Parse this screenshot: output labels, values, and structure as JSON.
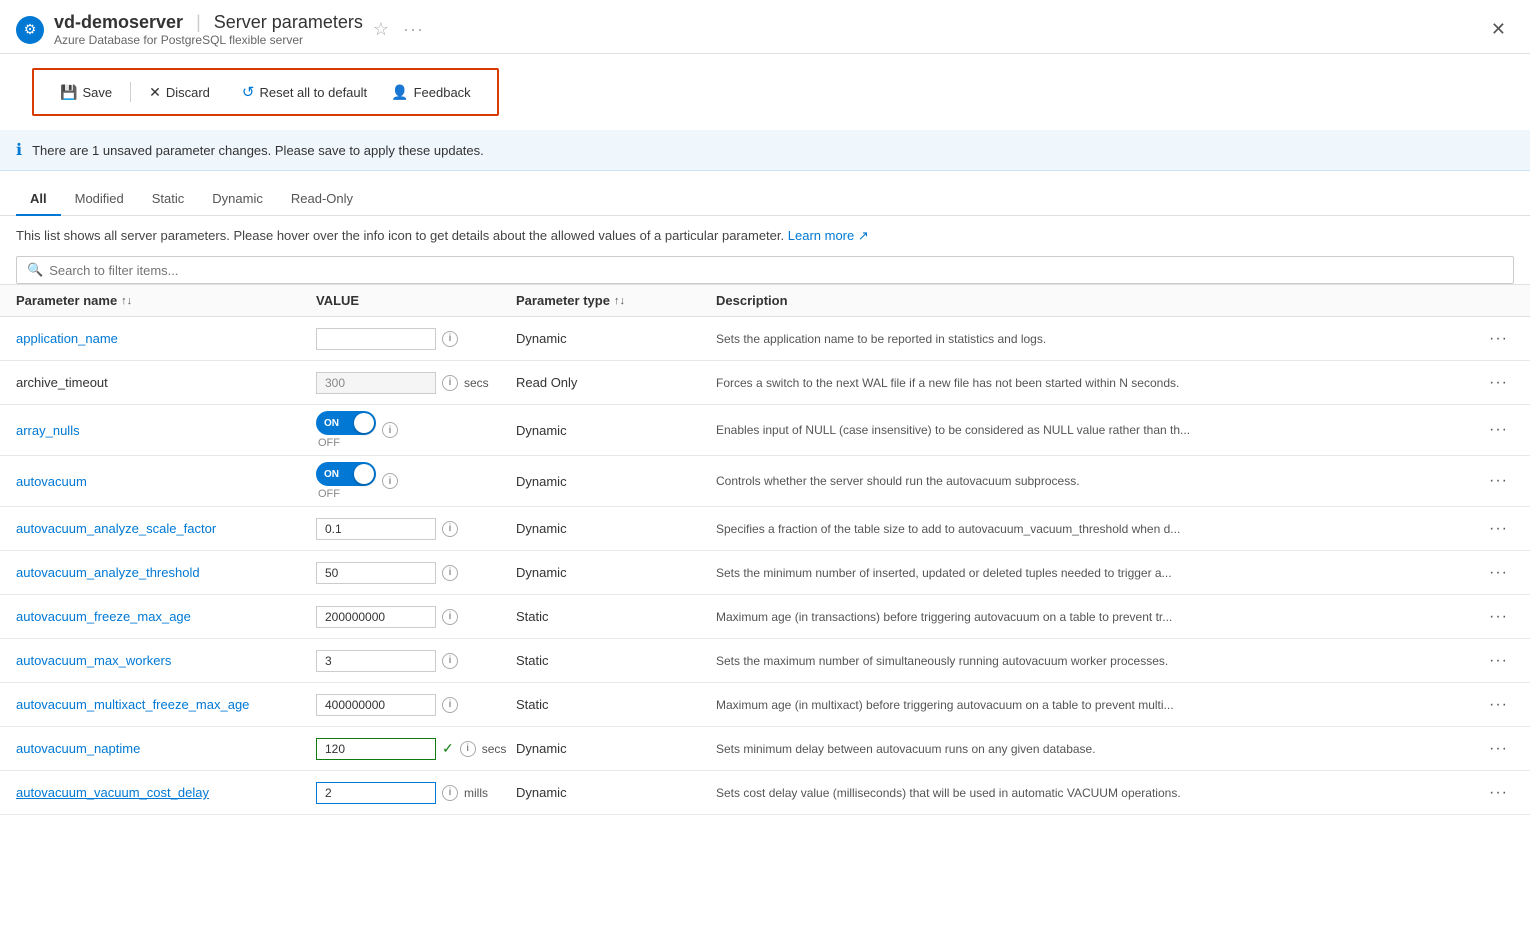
{
  "header": {
    "icon": "⚙",
    "server_name": "vd-demoserver",
    "divider": "|",
    "page_title": "Server parameters",
    "subtitle": "Azure Database for PostgreSQL flexible server"
  },
  "toolbar": {
    "save_label": "Save",
    "discard_label": "Discard",
    "reset_label": "Reset all to default",
    "feedback_label": "Feedback"
  },
  "info_banner": {
    "message": "There are 1 unsaved parameter changes.  Please save to apply these updates."
  },
  "tabs": [
    {
      "id": "all",
      "label": "All",
      "active": true
    },
    {
      "id": "modified",
      "label": "Modified",
      "active": false
    },
    {
      "id": "static",
      "label": "Static",
      "active": false
    },
    {
      "id": "dynamic",
      "label": "Dynamic",
      "active": false
    },
    {
      "id": "readonly",
      "label": "Read-Only",
      "active": false
    }
  ],
  "description": {
    "text": "This list shows all server parameters. Please hover over the info icon to get details about the allowed values of a particular parameter.",
    "link_text": "Learn more",
    "link_icon": "↗"
  },
  "search": {
    "placeholder": "Search to filter items..."
  },
  "table": {
    "columns": [
      {
        "label": "Parameter name",
        "sortable": true
      },
      {
        "label": "VALUE",
        "sortable": false
      },
      {
        "label": "Parameter type",
        "sortable": true
      },
      {
        "label": "Description",
        "sortable": false
      }
    ],
    "rows": [
      {
        "name": "application_name",
        "link": true,
        "value_type": "text",
        "value": "",
        "readonly": false,
        "modified": false,
        "highlighted_border": false,
        "unit": "",
        "param_type": "Dynamic",
        "description": "Sets the application name to be reported in statistics and logs."
      },
      {
        "name": "archive_timeout",
        "link": false,
        "value_type": "text",
        "value": "300",
        "readonly": true,
        "modified": false,
        "highlighted_border": false,
        "unit": "secs",
        "param_type": "Read Only",
        "description": "Forces a switch to the next WAL file if a new file has not been started within N seconds."
      },
      {
        "name": "array_nulls",
        "link": true,
        "value_type": "toggle",
        "value": "ON",
        "readonly": false,
        "modified": false,
        "highlighted_border": false,
        "unit": "",
        "param_type": "Dynamic",
        "description": "Enables input of NULL (case insensitive) to be considered as NULL value rather than th..."
      },
      {
        "name": "autovacuum",
        "link": true,
        "value_type": "toggle",
        "value": "ON",
        "readonly": false,
        "modified": false,
        "highlighted_border": false,
        "unit": "",
        "param_type": "Dynamic",
        "description": "Controls whether the server should run the autovacuum subprocess."
      },
      {
        "name": "autovacuum_analyze_scale_factor",
        "link": true,
        "value_type": "text",
        "value": "0.1",
        "readonly": false,
        "modified": false,
        "highlighted_border": false,
        "unit": "",
        "param_type": "Dynamic",
        "description": "Specifies a fraction of the table size to add to autovacuum_vacuum_threshold when d..."
      },
      {
        "name": "autovacuum_analyze_threshold",
        "link": true,
        "value_type": "text",
        "value": "50",
        "readonly": false,
        "modified": false,
        "highlighted_border": false,
        "unit": "",
        "param_type": "Dynamic",
        "description": "Sets the minimum number of inserted, updated or deleted tuples needed to trigger a..."
      },
      {
        "name": "autovacuum_freeze_max_age",
        "link": true,
        "value_type": "text",
        "value": "200000000",
        "readonly": false,
        "modified": false,
        "highlighted_border": false,
        "unit": "",
        "param_type": "Static",
        "description": "Maximum age (in transactions) before triggering autovacuum on a table to prevent tr..."
      },
      {
        "name": "autovacuum_max_workers",
        "link": true,
        "value_type": "text",
        "value": "3",
        "readonly": false,
        "modified": false,
        "highlighted_border": false,
        "unit": "",
        "param_type": "Static",
        "description": "Sets the maximum number of simultaneously running autovacuum worker processes."
      },
      {
        "name": "autovacuum_multixact_freeze_max_age",
        "link": true,
        "value_type": "text",
        "value": "400000000",
        "readonly": false,
        "modified": false,
        "highlighted_border": false,
        "unit": "",
        "param_type": "Static",
        "description": "Maximum age (in multixact) before triggering autovacuum on a table to prevent multi..."
      },
      {
        "name": "autovacuum_naptime",
        "link": true,
        "value_type": "text",
        "value": "120",
        "readonly": false,
        "modified": true,
        "highlighted_border": false,
        "unit": "secs",
        "param_type": "Dynamic",
        "description": "Sets minimum delay between autovacuum runs on any given database."
      },
      {
        "name": "autovacuum_vacuum_cost_delay",
        "link": true,
        "value_type": "text",
        "value": "2",
        "readonly": false,
        "modified": false,
        "highlighted_border": true,
        "unit": "mills",
        "param_type": "Dynamic",
        "description": "Sets cost delay value (milliseconds) that will be used in automatic VACUUM operations."
      }
    ]
  }
}
